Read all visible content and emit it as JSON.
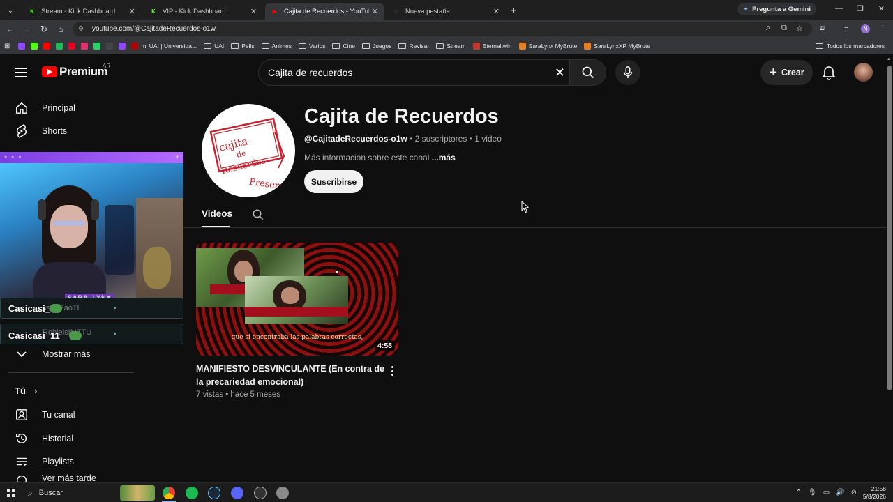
{
  "browser": {
    "tabs": [
      {
        "title": "Stream - Kick Dashboard",
        "favicon": "K",
        "favicon_color": "#53fc18",
        "active": false
      },
      {
        "title": "VIP - Kick Dashboard",
        "favicon": "K",
        "favicon_color": "#53fc18",
        "active": false
      },
      {
        "title": "Cajita de Recuerdos - YouTube",
        "favicon": "▶",
        "favicon_color": "#ff0000",
        "active": true
      },
      {
        "title": "Nueva pestaña",
        "favicon": "◌",
        "favicon_color": "#9aa0a6",
        "active": false
      }
    ],
    "gemini_label": "Pregunta a Gemini",
    "url": "youtube.com/@CajitadeRecuerdos-o1w",
    "bookmarks": [
      {
        "label": "",
        "type": "icon",
        "color": "#9146ff"
      },
      {
        "label": "",
        "type": "icon",
        "color": "#53fc18"
      },
      {
        "label": "",
        "type": "icon",
        "color": "#ff0000"
      },
      {
        "label": "",
        "type": "icon",
        "color": "#1db954"
      },
      {
        "label": "",
        "type": "icon",
        "color": "#e60023"
      },
      {
        "label": "",
        "type": "icon",
        "color": "#e1306c"
      },
      {
        "label": "",
        "type": "icon",
        "color": "#25d366"
      },
      {
        "label": "",
        "type": "icon",
        "color": "#444444"
      },
      {
        "label": "",
        "type": "icon",
        "color": "#9146ff"
      },
      {
        "label": "mi UAI | Universida...",
        "type": "site",
        "color": "#b30000"
      },
      {
        "label": "UAI",
        "type": "folder"
      },
      {
        "label": "Pelis",
        "type": "folder"
      },
      {
        "label": "Animes",
        "type": "folder"
      },
      {
        "label": "Varios",
        "type": "folder"
      },
      {
        "label": "Cine",
        "type": "folder"
      },
      {
        "label": "Juegos",
        "type": "folder"
      },
      {
        "label": "Revisar",
        "type": "folder"
      },
      {
        "label": "Stream",
        "type": "folder"
      },
      {
        "label": "Eternaltwin",
        "type": "site",
        "color": "#c0392b"
      },
      {
        "label": "SaraLynx MyBrute",
        "type": "site",
        "color": "#e67e22"
      },
      {
        "label": "SaraLynxXP MyBrute",
        "type": "site",
        "color": "#e67e22"
      }
    ],
    "all_bookmarks": "Todos los marcadores"
  },
  "youtube": {
    "logo_text": "Premium",
    "region": "AR",
    "search_value": "Cajita de recuerdos",
    "create_label": "Crear"
  },
  "sidebar": {
    "items": [
      {
        "label": "Principal",
        "icon": "home-icon"
      },
      {
        "label": "Shorts",
        "icon": "shorts-icon"
      }
    ],
    "chat": [
      {
        "name": "Casicasi_11",
        "ghost": "ssanPaoTL"
      },
      {
        "name": "Casicasi_11",
        "ghost": "RobleisIMTTU"
      }
    ],
    "streamer_badge": "SARA_LYNX",
    "show_more": "Mostrar más",
    "you_header": "Tú",
    "you_items": [
      {
        "label": "Tu canal",
        "icon": "channel-icon"
      },
      {
        "label": "Historial",
        "icon": "history-icon"
      },
      {
        "label": "Playlists",
        "icon": "playlists-icon"
      },
      {
        "label": "Ver más tarde",
        "icon": "watch-later-icon"
      }
    ]
  },
  "channel": {
    "name": "Cajita de Recuerdos",
    "handle": "@CajitadeRecuerdos-o1w",
    "subscribers": "2 suscriptores",
    "videos_count": "1 video",
    "separator": " • ",
    "description": "Más información sobre este canal",
    "more": " ...más",
    "subscribe_label": "Suscribirse",
    "avatar_text": [
      "cajita",
      "de",
      "Recuerdos",
      "Present"
    ],
    "tabs": [
      "Videos"
    ]
  },
  "video": {
    "title": "MANIFIESTO DESVINCULANTE (En contra de la precariedad emocional)",
    "views": "7 vistas",
    "age": "hace 5 meses",
    "duration": "4:58",
    "caption": "que si encontraba las palabras correctas,"
  },
  "taskbar": {
    "search_placeholder": "Buscar",
    "time": "21:58",
    "date": "5/8/2026"
  }
}
